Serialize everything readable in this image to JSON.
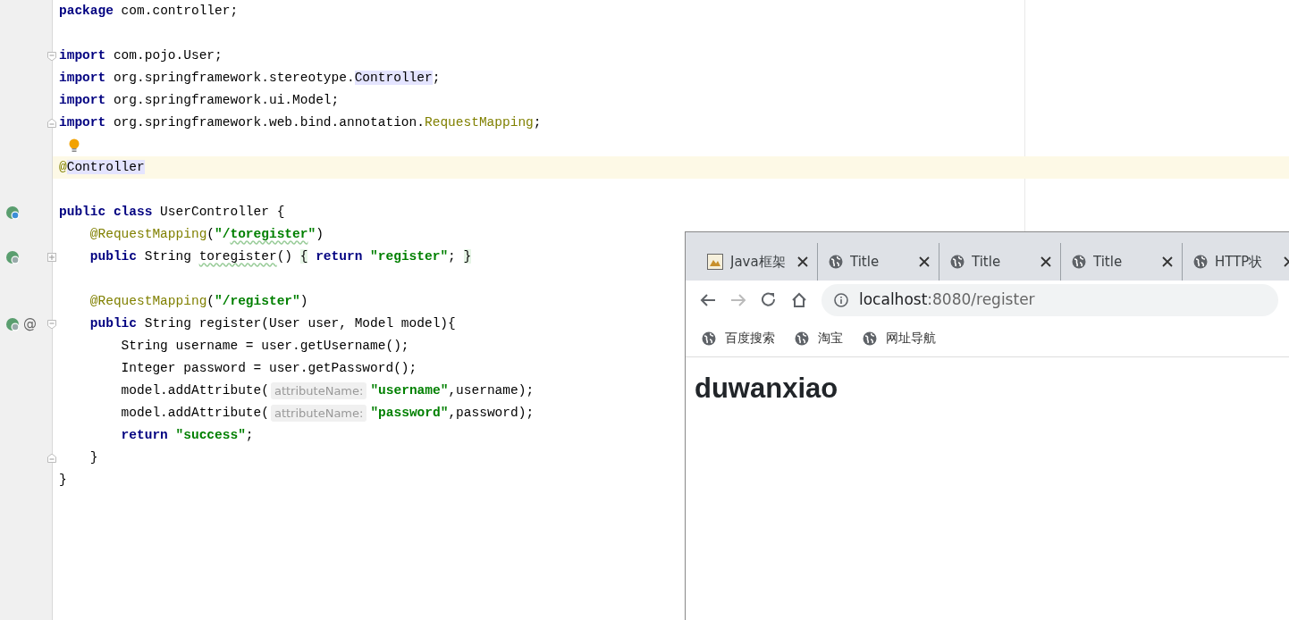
{
  "editor": {
    "lines": [
      {
        "tokens": [
          {
            "kind": "keyword",
            "text": "package"
          },
          {
            "kind": "plain",
            "text": " com.controller;"
          }
        ]
      },
      {
        "space_before": true,
        "fold_start": true,
        "tokens": [
          {
            "kind": "keyword",
            "text": "import"
          },
          {
            "kind": "plain",
            "text": " com.pojo.User;"
          }
        ]
      },
      {
        "tokens": [
          {
            "kind": "keyword",
            "text": "import"
          },
          {
            "kind": "plain",
            "text": " org.springframework.stereotype."
          },
          {
            "kind": "match",
            "text": "Controller"
          },
          {
            "kind": "plain",
            "text": ";"
          }
        ]
      },
      {
        "tokens": [
          {
            "kind": "keyword",
            "text": "import"
          },
          {
            "kind": "plain",
            "text": " org.springframework.ui.Model;"
          }
        ]
      },
      {
        "fold_end": true,
        "tokens": [
          {
            "kind": "keyword",
            "text": "import"
          },
          {
            "kind": "plain",
            "text": " org.springframework.web.bind.annotation."
          },
          {
            "kind": "annotation",
            "text": "RequestMapping"
          },
          {
            "kind": "plain",
            "text": ";"
          }
        ]
      },
      {
        "bulb": true
      },
      {
        "current": true,
        "tokens": [
          {
            "kind": "annotation",
            "text": "@"
          },
          {
            "kind": "match",
            "text": "Controller"
          }
        ]
      },
      {
        "space_before": true,
        "class_marker": true,
        "tokens": [
          {
            "kind": "keyword",
            "text": "public class"
          },
          {
            "kind": "plain",
            "text": " UserController {"
          }
        ]
      },
      {
        "tokens": [
          {
            "kind": "annotation",
            "text": "    @RequestMapping"
          },
          {
            "kind": "plain",
            "text": "("
          },
          {
            "kind": "string",
            "text": "\"/"
          },
          {
            "kind": "string-typo",
            "text": "toregister"
          },
          {
            "kind": "string",
            "text": "\""
          },
          {
            "kind": "plain",
            "text": ")"
          }
        ]
      },
      {
        "method_marker": true,
        "folded": true,
        "tokens": [
          {
            "kind": "keyword",
            "text": "    public"
          },
          {
            "kind": "plain",
            "text": " String "
          },
          {
            "kind": "typo",
            "text": "toregister"
          },
          {
            "kind": "plain",
            "text": "() "
          },
          {
            "kind": "brace",
            "text": "{"
          },
          {
            "kind": "keyword",
            "text": " return "
          },
          {
            "kind": "string",
            "text": "\"register\""
          },
          {
            "kind": "plain",
            "text": "; "
          },
          {
            "kind": "brace",
            "text": "}"
          }
        ]
      },
      {
        "space_before": true,
        "tokens": [
          {
            "kind": "annotation",
            "text": "    @RequestMapping"
          },
          {
            "kind": "plain",
            "text": "("
          },
          {
            "kind": "string",
            "text": "\"/register\""
          },
          {
            "kind": "plain",
            "text": ")"
          }
        ]
      },
      {
        "method_marker": true,
        "at": "@",
        "fold_start": true,
        "tokens": [
          {
            "kind": "keyword",
            "text": "    public"
          },
          {
            "kind": "plain",
            "text": " String register(User user, Model model){"
          }
        ]
      },
      {
        "tokens": [
          {
            "kind": "plain",
            "text": "        String username = user.getUsername();"
          }
        ]
      },
      {
        "tokens": [
          {
            "kind": "plain",
            "text": "        Integer password = user.getPassword();"
          }
        ]
      },
      {
        "tokens": [
          {
            "kind": "plain",
            "text": "        model.addAttribute("
          },
          {
            "kind": "hint",
            "text": "attributeName:"
          },
          {
            "kind": "string",
            "text": "\"username\""
          },
          {
            "kind": "plain",
            "text": ",username);"
          }
        ]
      },
      {
        "tokens": [
          {
            "kind": "plain",
            "text": "        model.addAttribute("
          },
          {
            "kind": "hint",
            "text": "attributeName:"
          },
          {
            "kind": "string",
            "text": "\"password\""
          },
          {
            "kind": "plain",
            "text": ",password);"
          }
        ]
      },
      {
        "tokens": [
          {
            "kind": "keyword",
            "text": "        return"
          },
          {
            "kind": "string",
            "text": " \"success\""
          },
          {
            "kind": "plain",
            "text": ";"
          }
        ]
      },
      {
        "fold_end": true,
        "tokens": [
          {
            "kind": "plain",
            "text": "    }"
          }
        ]
      },
      {
        "tokens": [
          {
            "kind": "plain",
            "text": "}"
          }
        ]
      }
    ]
  },
  "browser": {
    "tabs": [
      {
        "label": "Java框架",
        "selected": false
      },
      {
        "label": "Title",
        "selected": false
      },
      {
        "label": "Title",
        "selected": false
      },
      {
        "label": "Title",
        "selected": false
      },
      {
        "label": "HTTP状",
        "selected": false
      }
    ],
    "nav": {
      "back_disabled": false,
      "forward_disabled": true
    },
    "url": {
      "host": "localhost",
      "path": ":8080/register"
    },
    "bookmarks": [
      "百度搜索",
      "淘宝",
      "网址导航"
    ],
    "page": {
      "heading": "duwanxiao"
    }
  }
}
